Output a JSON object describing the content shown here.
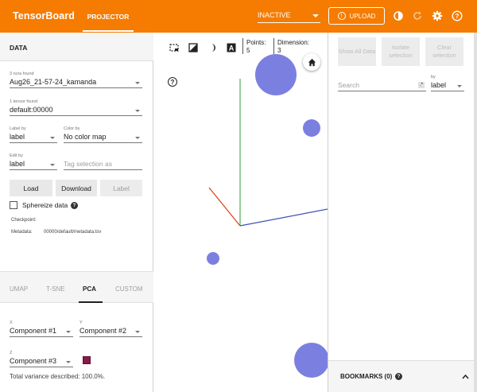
{
  "app": {
    "title": "TensorBoard",
    "tab": "PROJECTOR",
    "status_select": "INACTIVE",
    "upload_label": "UPLOAD"
  },
  "data_panel": {
    "header": "DATA",
    "runs_found_label": "3 runs found",
    "run_value": "Aug26_21-57-24_kamanda",
    "tensor_found_label": "1 tensor found",
    "tensor_value": "default:00000",
    "label_by_label": "Label by",
    "label_by_value": "label",
    "color_by_label": "Color by",
    "color_by_value": "No color map",
    "edit_by_label": "Edit by",
    "edit_by_value": "label",
    "tag_placeholder": "Tag selection as",
    "buttons": {
      "load": "Load",
      "download": "Download",
      "label": "Label"
    },
    "sphereize_label": "Sphereize data",
    "checkpoint_label": "Checkpoint:",
    "metadata_label": "Metadata:",
    "metadata_value": "00000/default/metadata.tsv"
  },
  "projection_tabs": [
    {
      "label": "UMAP",
      "active": false
    },
    {
      "label": "T-SNE",
      "active": false
    },
    {
      "label": "PCA",
      "active": true
    },
    {
      "label": "CUSTOM",
      "active": false
    }
  ],
  "pca": {
    "x_label": "X",
    "x_value": "Component #1",
    "y_label": "Y",
    "y_value": "Component #2",
    "z_label": "Z",
    "z_value": "Component #3",
    "variance_text": "Total variance described: 100.0%.",
    "swatch_color": "#8b1a4a"
  },
  "viewer": {
    "points_label": "Points:",
    "points_value": "5",
    "dimension_label": "Dimension:",
    "dimension_value": "3",
    "point_color": "#7b80e0",
    "icons": [
      "select-box-icon",
      "night-mode-icon",
      "moon-icon",
      "label-a-icon",
      "home-icon",
      "help-icon"
    ]
  },
  "inspector": {
    "buttons": {
      "show_all": "Show All Data",
      "isolate": "Isolate selection",
      "clear": "Clear selection"
    },
    "search_placeholder": "Search",
    "by_label": "by",
    "by_value": "label",
    "bookmarks_label": "BOOKMARKS (0)"
  }
}
